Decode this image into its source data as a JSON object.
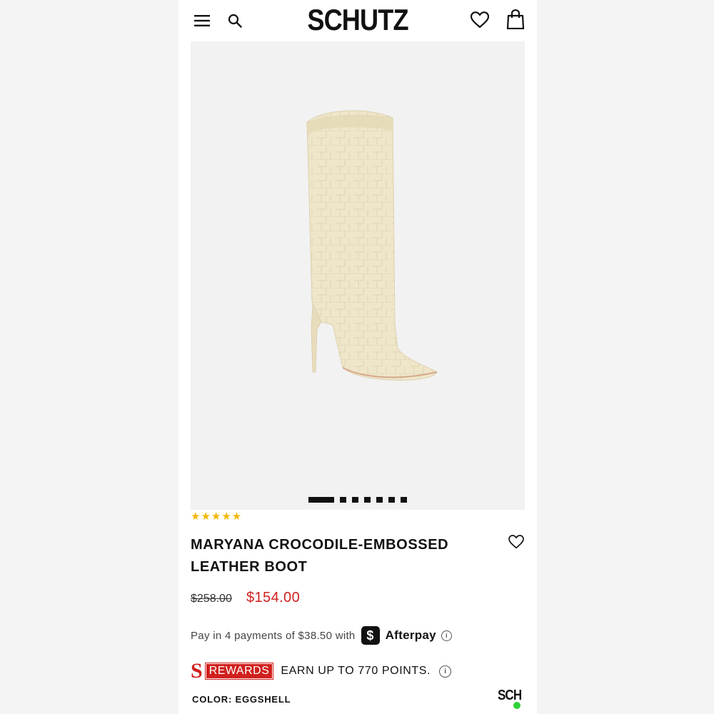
{
  "header": {
    "logo": "SCHUTZ",
    "icons": [
      "menu-icon",
      "search-icon",
      "heart-icon",
      "shopping-bag-icon"
    ]
  },
  "gallery": {
    "slide_count": 7,
    "active_slide": 1
  },
  "product": {
    "rating_stars": "★★★★★",
    "rating": 5,
    "title_line1": "MARYANA CROCODILE-EMBOSSED",
    "title_line2": "LEATHER BOOT",
    "original_price": "$258.00",
    "sale_price": "$154.00",
    "color_label": "COLOR: EGGSHELL"
  },
  "payment": {
    "text": "Pay in 4 payments of $38.50 with",
    "badge": "$",
    "provider": "Afterpay",
    "info": "i"
  },
  "rewards": {
    "s_logo": "S",
    "badge": "REWARDS",
    "text": "EARN UP TO 770 POINTS.",
    "info": "i"
  },
  "chat": {
    "label": "SCH",
    "status_color": "#2fd23a"
  },
  "colors": {
    "accent_red": "#d0201e",
    "star_yellow": "#f2b705",
    "boot_cream": "#efe6c9"
  }
}
